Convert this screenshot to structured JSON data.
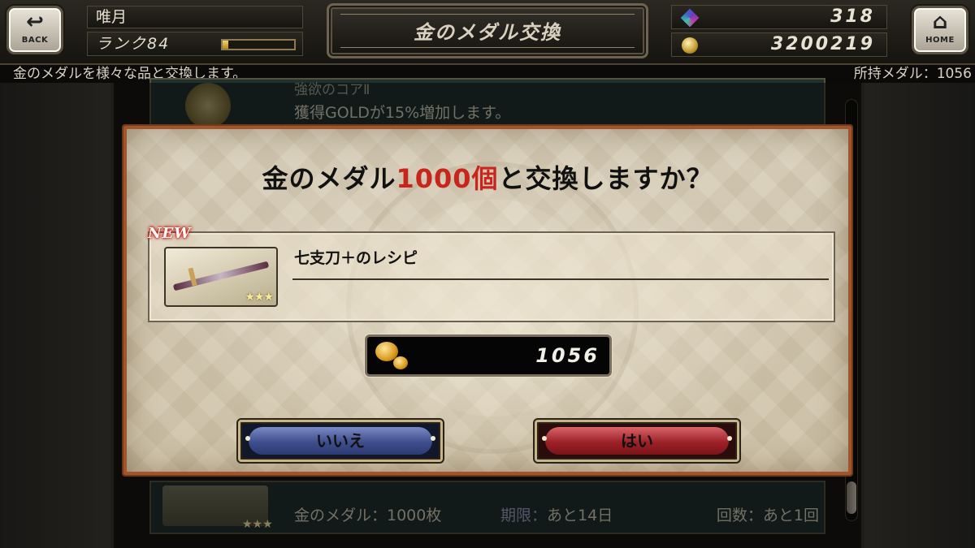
{
  "header": {
    "back_label": "BACK",
    "home_label": "HOME",
    "player_name": "唯月",
    "rank_label": "ランク84",
    "rank_progress": 0.08,
    "title": "金のメダル交換",
    "gems": "318",
    "gold": "3200219"
  },
  "info_bar": {
    "description": "金のメダルを様々な品と交換します。",
    "owned_medals": "所持メダル：1056"
  },
  "list": {
    "top_item_title": "強欲のコアⅡ",
    "top_item_desc": "獲得GOLDが15%増加します。",
    "bottom_item_cost": "金のメダル：1000枚",
    "bottom_item_limit_label": "期限：",
    "bottom_item_limit_value": "あと14日",
    "bottom_item_count": "回数：あと1回"
  },
  "dialog": {
    "question_prefix": "金のメダル",
    "question_highlight": "1000個",
    "question_suffix": "と交換しますか？",
    "new_badge": "NEW",
    "item_name": "七支刀＋のレシピ",
    "item_stars": "★★★",
    "balance": "1056",
    "no_label": "いいえ",
    "yes_label": "はい",
    "highlight_color": "#c8261c"
  }
}
